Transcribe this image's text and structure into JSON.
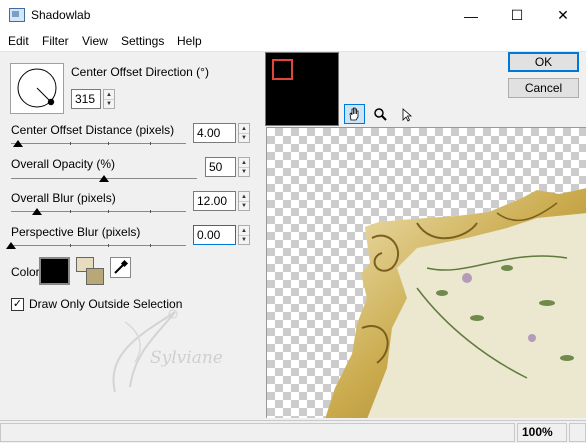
{
  "window": {
    "title": "Shadowlab",
    "minimize": "—",
    "maximize": "☐",
    "close": "✕"
  },
  "menu": [
    "Edit",
    "Filter",
    "View",
    "Settings",
    "Help"
  ],
  "controls": {
    "direction_label": "Center Offset Direction (°)",
    "direction_value": "315",
    "distance_label": "Center Offset Distance (pixels)",
    "distance_value": "4.00",
    "distance_slider_fraction": 0.04,
    "opacity_label": "Overall Opacity (%)",
    "opacity_value": "50",
    "opacity_slider_fraction": 0.5,
    "blur_label": "Overall Blur (pixels)",
    "blur_value": "12.00",
    "blur_slider_fraction": 0.15,
    "perspective_label": "Perspective Blur (pixels)",
    "perspective_value": "0.00",
    "perspective_slider_fraction": 0.0,
    "color_label": "Color",
    "checkbox_label": "Draw Only Outside Selection",
    "checkbox_checked": true
  },
  "colors": {
    "shadow": "#000000",
    "bg_swatch": "#e8dcc0",
    "fg_swatch": "#b8a878",
    "frame": "#e0463c",
    "accent": "#0078d7"
  },
  "buttons": {
    "ok": "OK",
    "cancel": "Cancel"
  },
  "tools": [
    "hand-icon",
    "zoom-icon",
    "arrow-icon"
  ],
  "watermark": "Sylviane",
  "status": {
    "zoom": "100%"
  }
}
